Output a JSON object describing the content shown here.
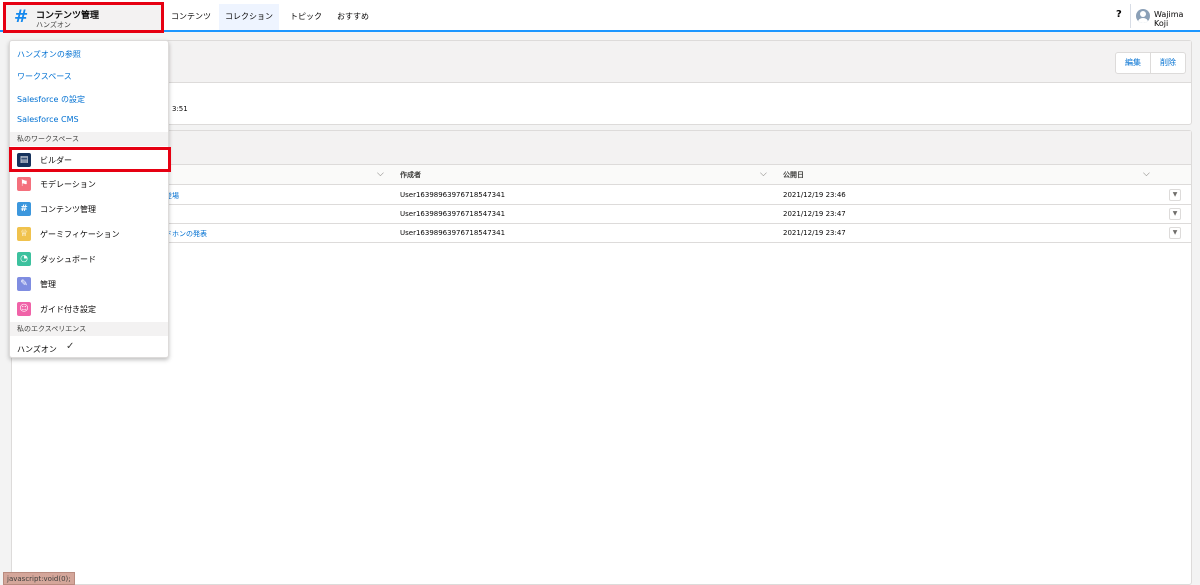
{
  "app": {
    "title": "コンテンツ管理",
    "subtitle": "ハンズオン",
    "icon": "hash-icon"
  },
  "tabs": [
    {
      "label": "コンテンツ",
      "active": false
    },
    {
      "label": "コレクション",
      "active": true
    },
    {
      "label": "トピック",
      "active": false
    },
    {
      "label": "おすすめ",
      "active": false
    }
  ],
  "header_right": {
    "help": "?",
    "user": "Wajima Koji"
  },
  "record": {
    "buttons": [
      "編集",
      "削除"
    ],
    "time_fragment": "3:51"
  },
  "table": {
    "columns": [
      "作成者",
      "公開日"
    ],
    "rows": [
      {
        "title_fragment": "ン登場",
        "author": "User16398963976718547341",
        "date": "2021/12/19 23:46"
      },
      {
        "title_fragment": "",
        "author": "User16398963976718547341",
        "date": "2021/12/19 23:47"
      },
      {
        "title_fragment": "ッドホンの発表",
        "author": "User16398963976718547341",
        "date": "2021/12/19 23:47"
      }
    ]
  },
  "menu": {
    "links": [
      "ハンズオンの参照",
      "ワークスペース",
      "Salesforce の設定",
      "Salesforce CMS"
    ],
    "section_workspaces": "私のワークスペース",
    "workspaces": [
      {
        "label": "ビルダー",
        "icon": "builder-icon",
        "color": "#16325c"
      },
      {
        "label": "モデレーション",
        "icon": "flag-icon",
        "color": "#f4707d"
      },
      {
        "label": "コンテンツ管理",
        "icon": "hash-icon",
        "color": "#3c97dd"
      },
      {
        "label": "ゲーミフィケーション",
        "icon": "trophy-icon",
        "color": "#f0c24d"
      },
      {
        "label": "ダッシュボード",
        "icon": "gauge-icon",
        "color": "#3cc19e"
      },
      {
        "label": "管理",
        "icon": "wrench-icon",
        "color": "#7f8de1"
      },
      {
        "label": "ガイド付き設定",
        "icon": "person-icon",
        "color": "#f063a8"
      }
    ],
    "section_experiences": "私のエクスペリエンス",
    "experience": "ハンズオン"
  },
  "status_bar": "javascript:void(0);"
}
